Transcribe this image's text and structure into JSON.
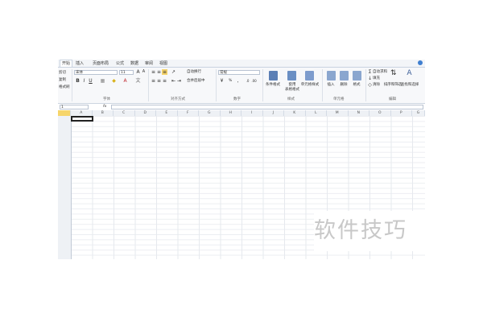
{
  "ribbon_tabs": [
    "开始",
    "插入",
    "页面布局",
    "公式",
    "数据",
    "审阅",
    "视图"
  ],
  "clipboard": {
    "cut": "剪切",
    "copy": "复制",
    "format_painter": "格式刷"
  },
  "font": {
    "name": "宋体",
    "size": "11",
    "group_label": "字体"
  },
  "alignment": {
    "wrap_text": "自动换行",
    "merge_center": "合并后居中",
    "group_label": "对齐方式"
  },
  "number": {
    "format": "常规",
    "percent": "%",
    "group_label": "数字"
  },
  "styles": {
    "conditional_format": "条件格式",
    "format_as_table": "套用",
    "format_as_table_2": "表格格式",
    "cell_styles": "单元格样式",
    "group_label": "样式"
  },
  "cells": {
    "insert": "插入",
    "delete": "删除",
    "format": "格式",
    "group_label": "单元格"
  },
  "editing": {
    "autosum": "自动求和",
    "fill": "填充",
    "clear": "清除",
    "sort_filter": "排序和筛选",
    "find_select": "查找和选择",
    "group_label": "编辑"
  },
  "formula_bar": {
    "name_box": "1",
    "fx": "fx"
  },
  "columns": [
    "A",
    "B",
    "C",
    "D",
    "E",
    "F",
    "G",
    "H",
    "I",
    "J",
    "K",
    "L",
    "M",
    "N",
    "O",
    "P",
    "G"
  ],
  "watermark": "软件技巧"
}
